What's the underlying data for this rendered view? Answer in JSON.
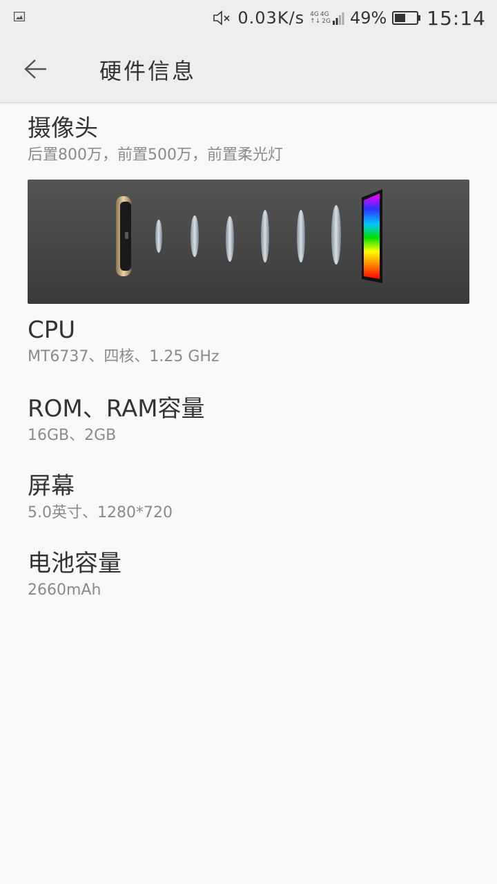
{
  "status_bar": {
    "net_speed": "0.03K/s",
    "net_type_top_a": "4G",
    "net_type_top_b": "4G",
    "net_type_bottom_arrows": "↑↓",
    "net_type_bottom_b": "2G",
    "battery_percent": "49%",
    "battery_level": 0.49,
    "time": "15:14",
    "icons": [
      "gallery-icon",
      "mute-icon",
      "signal-icon",
      "battery-icon"
    ]
  },
  "app_bar": {
    "title": "硬件信息",
    "back_icon": "back-arrow-icon"
  },
  "items": [
    {
      "title": "摄像头",
      "subtitle": "后置800万，前置500万，前置柔光灯"
    },
    {
      "title": "CPU",
      "subtitle": "MT6737、四核、1.25 GHz"
    },
    {
      "title": "ROM、RAM容量",
      "subtitle": "16GB、2GB"
    },
    {
      "title": "屏幕",
      "subtitle": "5.0英寸、1280*720"
    },
    {
      "title": "电池容量",
      "subtitle": "2660mAh"
    }
  ],
  "colors": {
    "status_bg": "#eeeeee",
    "page_bg": "#f9f9f9",
    "title_text": "#333333",
    "subtitle_text": "#8a8a8a",
    "banner_bg": "#444444",
    "camera_ring": "#c8aa78"
  }
}
